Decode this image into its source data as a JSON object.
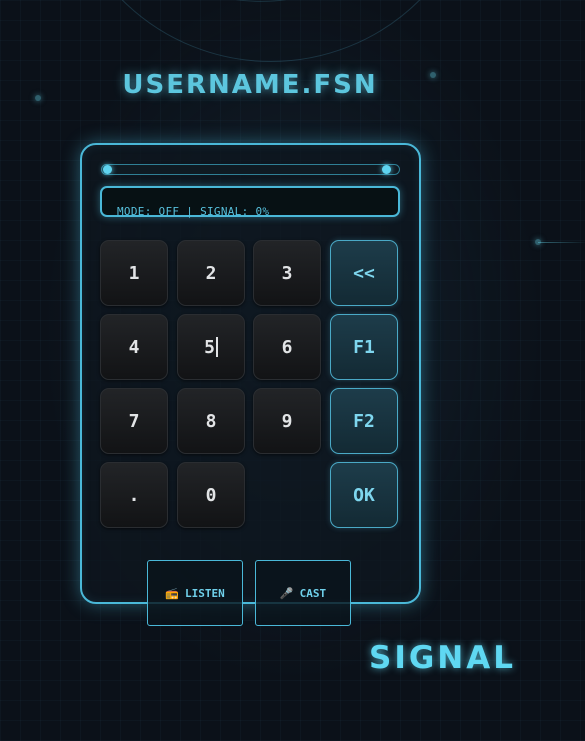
{
  "header": {
    "title": "USERNAME.FSN"
  },
  "status_display": {
    "text": "MODE: OFF | SIGNAL: 0%"
  },
  "slider": {
    "min_value": 0,
    "max_value": 1
  },
  "keypad": {
    "keys": [
      "1",
      "2",
      "3",
      "<<",
      "4",
      "5",
      "6",
      "F1",
      "7",
      "8",
      "9",
      "F2",
      ".",
      "0",
      "OK"
    ]
  },
  "actions": {
    "listen": {
      "icon": "radio-icon",
      "label": "LISTEN"
    },
    "cast": {
      "icon": "microphone-icon",
      "label": "CAST"
    }
  },
  "brand": {
    "label": "SIGNAL"
  },
  "colors": {
    "accent": "#4ab8d8",
    "background": "#0b1119",
    "key_dark": "#1b1d20",
    "key_function": "#1d3c4a"
  }
}
